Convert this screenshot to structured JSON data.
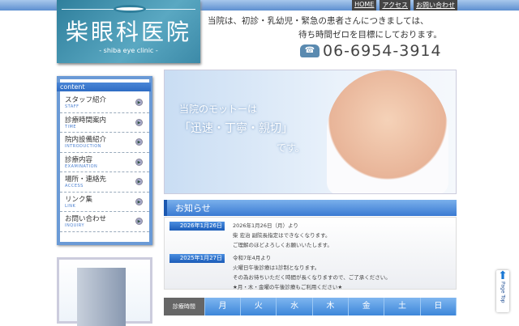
{
  "topnav": [
    "HOME",
    "アクセス",
    "お問い合わせ"
  ],
  "logo": {
    "name": "柴眼科医院",
    "sub": "- shiba eye clinic -"
  },
  "tagline": [
    "当院は、初診・乳幼児・緊急の患者さんにつきましては、",
    "待ち時間ゼロを目標にしております。"
  ],
  "phone": "06-6954-3914",
  "sidebar": {
    "heading": "content",
    "items": [
      {
        "jp": "スタッフ紹介",
        "en": "STAFF"
      },
      {
        "jp": "診療時間案内",
        "en": "TIME"
      },
      {
        "jp": "院内設備紹介",
        "en": "INTRODUCTION"
      },
      {
        "jp": "診療内容",
        "en": "EXAMINATION"
      },
      {
        "jp": "場所・連絡先",
        "en": "ACCESS"
      },
      {
        "jp": "リンク集",
        "en": "LINK"
      },
      {
        "jp": "お問い合わせ",
        "en": "INQUIRY"
      }
    ]
  },
  "hero": {
    "motto": [
      "当院のモットーは",
      "「迅速・丁寧・親切」",
      "です。"
    ]
  },
  "notices": {
    "title": "お知らせ",
    "items": [
      {
        "date": "2026年1月26日",
        "lines": [
          "2026年1月26日（月）より",
          "柴 宏治 副院長指定はできなくなります。",
          "ご理解のほどよろしくお願いいたします。"
        ]
      },
      {
        "date": "2025年1月27日",
        "lines": [
          "令和7年4月より",
          "火曜日午後診療は1診制となります。",
          "その為お待ちいただく時間が長くなりますので、ご了承ください。",
          "★月・木・金曜の午後診療もご利用ください★"
        ]
      }
    ]
  },
  "hours": {
    "header": [
      "診療時間",
      "月",
      "火",
      "水",
      "木",
      "金",
      "土",
      "日"
    ]
  },
  "pagetop": "Page Top"
}
